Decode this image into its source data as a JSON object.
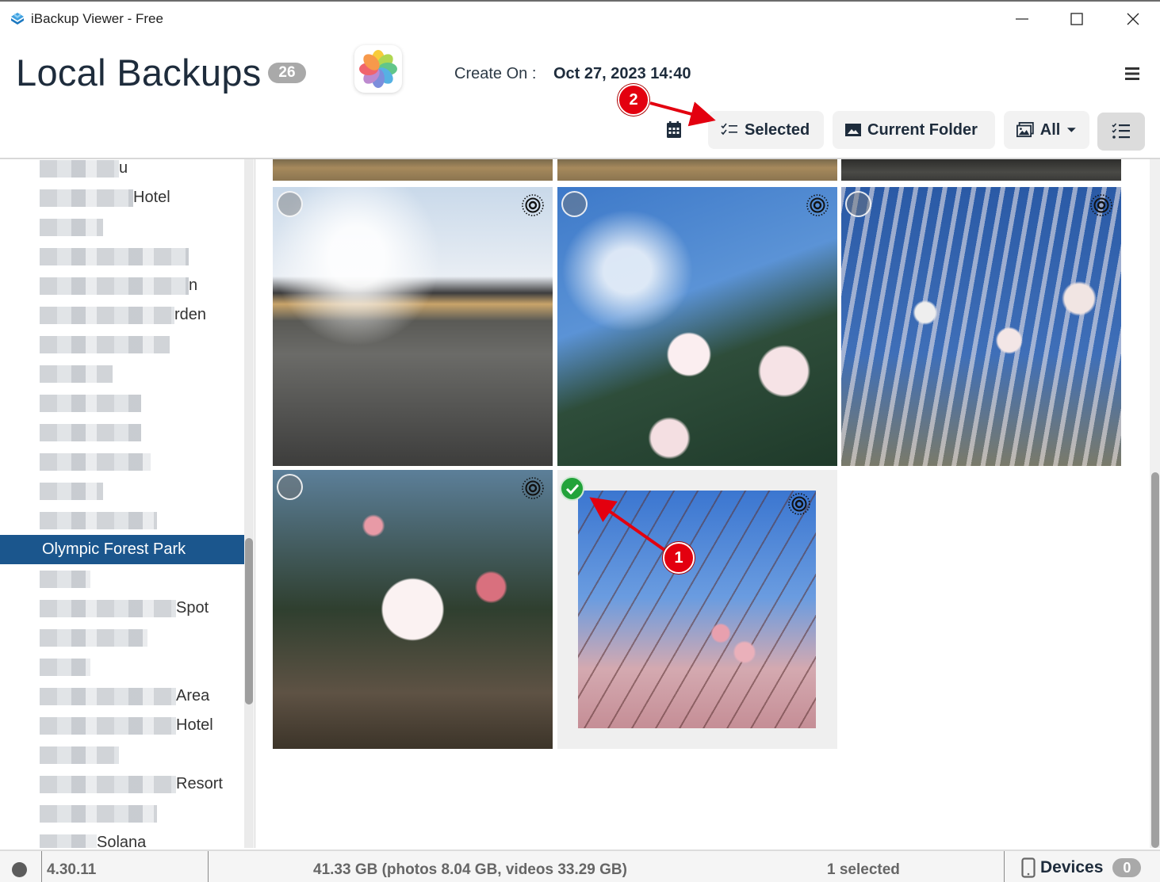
{
  "window": {
    "title": "iBackup Viewer - Free",
    "controls": [
      "minimize",
      "maximize",
      "close"
    ]
  },
  "header": {
    "title": "Local Backups",
    "backup_count": "26",
    "app_icon": "photos-app-icon",
    "create_label": "Create On :",
    "create_value": "Oct 27, 2023 14:40",
    "menu_icon": "hamburger-menu-icon"
  },
  "toolbar": {
    "calendar_icon": "calendar-icon",
    "selected_label": "Selected",
    "current_folder_label": "Current Folder",
    "filter_label": "All",
    "view_icon": "checklist-view-icon"
  },
  "annotations": [
    {
      "number": "1",
      "points_to": "selection-check"
    },
    {
      "number": "2",
      "points_to": "selected-button"
    }
  ],
  "sidebar": {
    "items": [
      {
        "visible_text": "u",
        "blurred": true
      },
      {
        "visible_text": "Hotel",
        "blurred": true
      },
      {
        "visible_text": "",
        "blurred": true
      },
      {
        "visible_text": "",
        "blurred": true
      },
      {
        "visible_text": "n",
        "blurred": true
      },
      {
        "visible_text": "rden",
        "blurred": true
      },
      {
        "visible_text": "",
        "blurred": true
      },
      {
        "visible_text": "",
        "blurred": true
      },
      {
        "visible_text": "",
        "blurred": true
      },
      {
        "visible_text": "",
        "blurred": true
      },
      {
        "visible_text": "",
        "blurred": true
      },
      {
        "visible_text": "",
        "blurred": true
      },
      {
        "visible_text": "",
        "blurred": true
      },
      {
        "visible_text": "Olympic Forest Park",
        "blurred": false,
        "active": true
      },
      {
        "visible_text": "",
        "blurred": true
      },
      {
        "visible_text": "Spot",
        "blurred": true
      },
      {
        "visible_text": "",
        "blurred": true
      },
      {
        "visible_text": "",
        "blurred": true
      },
      {
        "visible_text": "Area",
        "blurred": true
      },
      {
        "visible_text": "Hotel",
        "blurred": true
      },
      {
        "visible_text": "",
        "blurred": true
      },
      {
        "visible_text": "Resort",
        "blurred": true
      },
      {
        "visible_text": "",
        "blurred": true
      },
      {
        "visible_text": "Solana",
        "blurred": true
      }
    ]
  },
  "photos": [
    {
      "scene": "park path with bare trees",
      "live": true,
      "selected": false
    },
    {
      "scene": "white blossom against blue sky",
      "live": true,
      "selected": false
    },
    {
      "scene": "blossoming branches against blue sky",
      "live": true,
      "selected": false
    },
    {
      "scene": "white blossom with pink buds",
      "live": true,
      "selected": false
    },
    {
      "scene": "pink buds on branches",
      "live": true,
      "selected": true
    }
  ],
  "status": {
    "version": "4.30.11",
    "storage": "41.33 GB (photos 8.04 GB, videos 33.29 GB)",
    "selection": "1 selected",
    "devices_label": "Devices",
    "devices_count": "0"
  },
  "colors": {
    "accent": "#1b568d",
    "selected_check": "#22a33a",
    "annotation": "#e3000f",
    "badge": "#a9a9a9"
  }
}
